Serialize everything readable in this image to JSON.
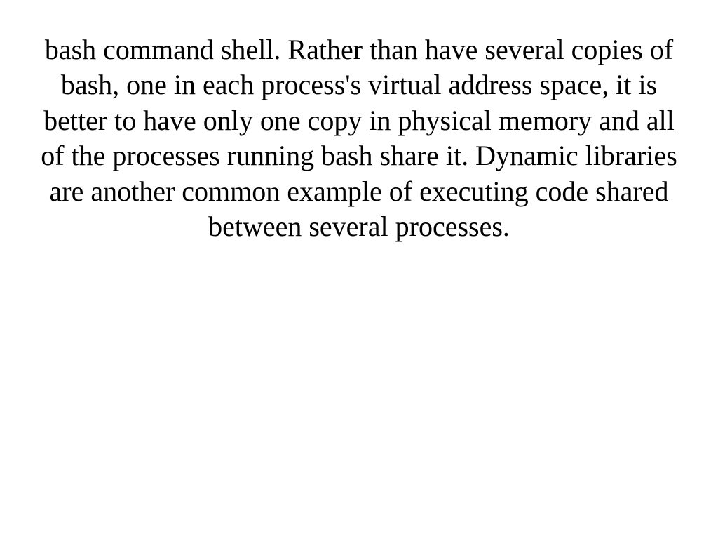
{
  "document": {
    "body": "bash command shell. Rather than have several copies of bash, one in each process's virtual address space, it is better to have only one copy in physical memory and all of the processes running bash share it. Dynamic libraries are another common example of executing code shared between several processes."
  }
}
